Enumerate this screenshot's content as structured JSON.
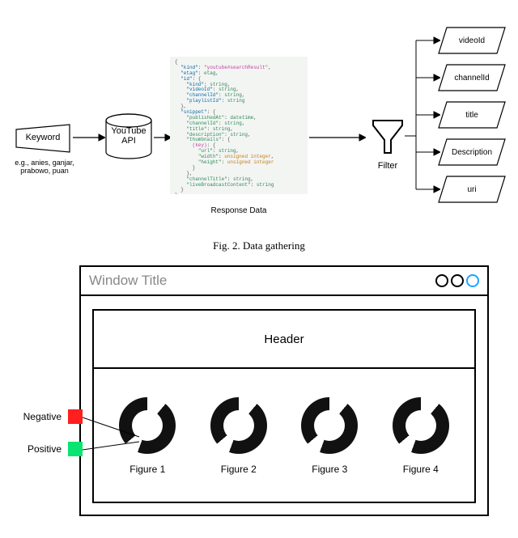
{
  "top": {
    "keyword_label": "Keyword",
    "keyword_examples": "e.g., anies, ganjar, prabowo, puan",
    "api_label": "YouTube API",
    "response_label": "Response Data",
    "filter_label": "Filter",
    "outputs": [
      "videoId",
      "channelId",
      "title",
      "Description",
      "uri"
    ],
    "code_lines": [
      {
        "indent": 0,
        "parts": [
          [
            "{",
            ""
          ]
        ]
      },
      {
        "indent": 1,
        "parts": [
          [
            "\"kind\"",
            "blue"
          ],
          [
            ": ",
            ""
          ],
          [
            "\"youtube#searchResult\"",
            "pink"
          ],
          [
            ",",
            ""
          ]
        ]
      },
      {
        "indent": 1,
        "parts": [
          [
            "\"etag\"",
            "blue"
          ],
          [
            ": ",
            ""
          ],
          [
            "etag",
            "green"
          ],
          [
            ",",
            ""
          ]
        ]
      },
      {
        "indent": 1,
        "parts": [
          [
            "\"id\"",
            "blue"
          ],
          [
            ": {",
            ""
          ]
        ]
      },
      {
        "indent": 2,
        "parts": [
          [
            "\"kind\"",
            "blue"
          ],
          [
            ": ",
            ""
          ],
          [
            "string",
            "green"
          ],
          [
            ",",
            ""
          ]
        ]
      },
      {
        "indent": 2,
        "parts": [
          [
            "\"videoId\"",
            "blue"
          ],
          [
            ": ",
            ""
          ],
          [
            "string",
            "green"
          ],
          [
            ",",
            ""
          ]
        ]
      },
      {
        "indent": 2,
        "parts": [
          [
            "\"channelId\"",
            "blue"
          ],
          [
            ": ",
            ""
          ],
          [
            "string",
            "green"
          ],
          [
            ",",
            ""
          ]
        ]
      },
      {
        "indent": 2,
        "parts": [
          [
            "\"playlistId\"",
            "blue"
          ],
          [
            ": ",
            ""
          ],
          [
            "string",
            "green"
          ]
        ]
      },
      {
        "indent": 1,
        "parts": [
          [
            "},",
            ""
          ]
        ]
      },
      {
        "indent": 1,
        "parts": [
          [
            "\"snippet\"",
            "blue"
          ],
          [
            ": {",
            ""
          ]
        ]
      },
      {
        "indent": 2,
        "parts": [
          [
            "\"publishedAt\"",
            "green"
          ],
          [
            ": ",
            ""
          ],
          [
            "datetime",
            "green"
          ],
          [
            ",",
            ""
          ]
        ]
      },
      {
        "indent": 2,
        "parts": [
          [
            "\"channelId\"",
            "green"
          ],
          [
            ": ",
            ""
          ],
          [
            "string",
            "green"
          ],
          [
            ",",
            ""
          ]
        ]
      },
      {
        "indent": 2,
        "parts": [
          [
            "\"title\"",
            "green"
          ],
          [
            ": ",
            ""
          ],
          [
            "string",
            "green"
          ],
          [
            ",",
            ""
          ]
        ]
      },
      {
        "indent": 2,
        "parts": [
          [
            "\"description\"",
            "green"
          ],
          [
            ": ",
            ""
          ],
          [
            "string",
            "green"
          ],
          [
            ",",
            ""
          ]
        ]
      },
      {
        "indent": 2,
        "parts": [
          [
            "\"thumbnails\"",
            "green"
          ],
          [
            ": {",
            ""
          ]
        ]
      },
      {
        "indent": 3,
        "parts": [
          [
            "(key)",
            "pink"
          ],
          [
            ": {",
            ""
          ]
        ]
      },
      {
        "indent": 4,
        "parts": [
          [
            "\"url\"",
            "green"
          ],
          [
            ": ",
            ""
          ],
          [
            "string",
            "green"
          ],
          [
            ",",
            ""
          ]
        ]
      },
      {
        "indent": 4,
        "parts": [
          [
            "\"width\"",
            "green"
          ],
          [
            ": ",
            ""
          ],
          [
            "unsigned integer",
            "orange"
          ],
          [
            ",",
            ""
          ]
        ]
      },
      {
        "indent": 4,
        "parts": [
          [
            "\"height\"",
            "green"
          ],
          [
            ": ",
            ""
          ],
          [
            "unsigned integer",
            "orange"
          ]
        ]
      },
      {
        "indent": 3,
        "parts": [
          [
            "}",
            ""
          ]
        ]
      },
      {
        "indent": 2,
        "parts": [
          [
            "},",
            ""
          ]
        ]
      },
      {
        "indent": 2,
        "parts": [
          [
            "\"channelTitle\"",
            "green"
          ],
          [
            ": ",
            ""
          ],
          [
            "string",
            "green"
          ],
          [
            ",",
            ""
          ]
        ]
      },
      {
        "indent": 2,
        "parts": [
          [
            "\"liveBroadcastContent\"",
            "green"
          ],
          [
            ": ",
            ""
          ],
          [
            "string",
            "green"
          ]
        ]
      },
      {
        "indent": 1,
        "parts": [
          [
            "}",
            ""
          ]
        ]
      },
      {
        "indent": 0,
        "parts": [
          [
            "}",
            ""
          ]
        ]
      }
    ]
  },
  "caption1": "Fig. 2.   Data gathering",
  "wire": {
    "window_title": "Window Title",
    "header": "Header",
    "figures": [
      "Figure 1",
      "Figure 2",
      "Figure 3",
      "Figure 4"
    ],
    "legend_negative": "Negative",
    "legend_positive": "Positive"
  }
}
